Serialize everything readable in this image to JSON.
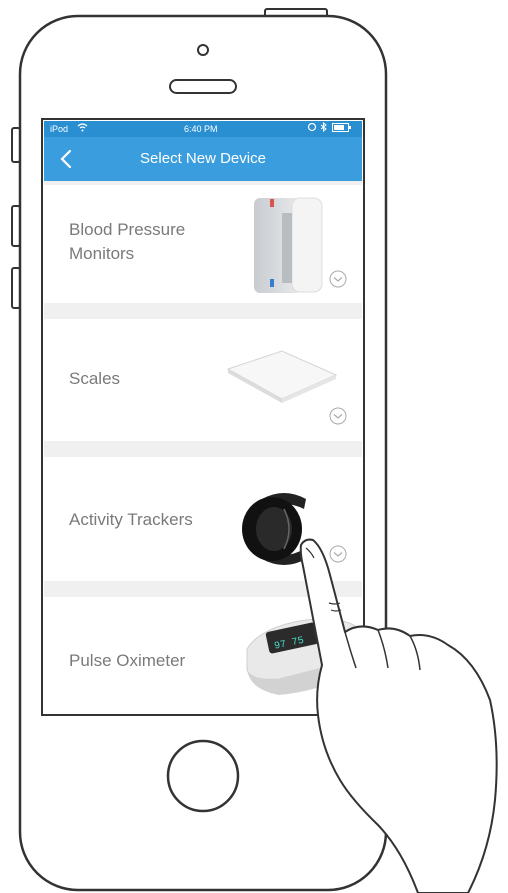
{
  "status_bar": {
    "carrier": "iPod",
    "time": "6:40 PM"
  },
  "nav": {
    "title": "Select New Device",
    "back_icon": "chevron-left-icon"
  },
  "devices": [
    {
      "label_line1": "Blood Pressure",
      "label_line2": "Monitors"
    },
    {
      "label_line1": "Scales"
    },
    {
      "label_line1": "Activity Trackers"
    },
    {
      "label_line1": "Pulse Oximeter"
    }
  ],
  "colors": {
    "nav_bar": "#3a9ddd",
    "status_bar": "#2a8fd1",
    "row_bg": "#ffffff",
    "separator": "#f0f0f0"
  }
}
